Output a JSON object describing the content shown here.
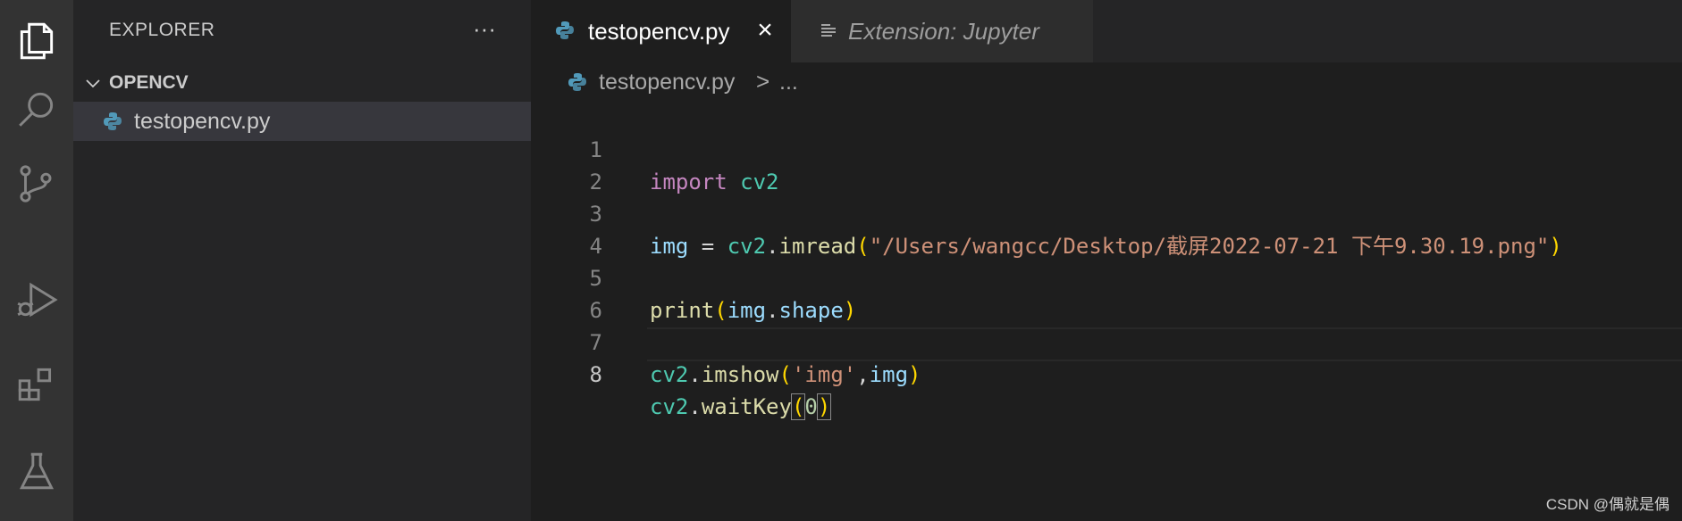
{
  "sidebar": {
    "title": "EXPLORER",
    "more_label": "···",
    "folder": "OPENCV",
    "file": "testopencv.py"
  },
  "tabs": [
    {
      "label": "testopencv.py",
      "active": true
    },
    {
      "label": "Extension: Jupyter",
      "active": false
    }
  ],
  "breadcrumb": {
    "file": "testopencv.py",
    "sep": ">",
    "rest": "..."
  },
  "editor": {
    "active_line": 8,
    "lines": [
      {
        "n": "1"
      },
      {
        "n": "2"
      },
      {
        "n": "3"
      },
      {
        "n": "4"
      },
      {
        "n": "5"
      },
      {
        "n": "6"
      },
      {
        "n": "7"
      },
      {
        "n": "8"
      }
    ],
    "code": {
      "l1": {
        "kw": "import",
        "mod": "cv2"
      },
      "l3": {
        "var": "img",
        "eq": " = ",
        "mod": "cv2",
        "dot": ".",
        "fn": "imread",
        "open": "(",
        "str": "\"/Users/wangcc/Desktop/截屏2022-07-21 下午9.30.19.png\"",
        "close": ")"
      },
      "l5": {
        "fn": "print",
        "open": "(",
        "var": "img",
        "dot": ".",
        "attr": "shape",
        "close": ")"
      },
      "l7": {
        "mod": "cv2",
        "dot": ".",
        "fn": "imshow",
        "open": "(",
        "str": "'img'",
        "comma": ",",
        "var": "img",
        "close": ")"
      },
      "l8": {
        "mod": "cv2",
        "dot": ".",
        "fn": "waitKey",
        "open": "(",
        "num": "0",
        "close": ")"
      }
    }
  },
  "watermark": "CSDN @偶就是偶",
  "colors": {
    "background": "#1e1e1e",
    "activity_bar": "#333333",
    "sidebar": "#252526",
    "selected_file": "#37373d",
    "python_icon": "#519aba"
  },
  "icons": [
    "files-icon",
    "search-icon",
    "source-control-icon",
    "run-debug-icon",
    "extensions-icon",
    "testing-icon",
    "python-file-icon",
    "close-icon",
    "preview-icon",
    "chevron-down-icon"
  ]
}
